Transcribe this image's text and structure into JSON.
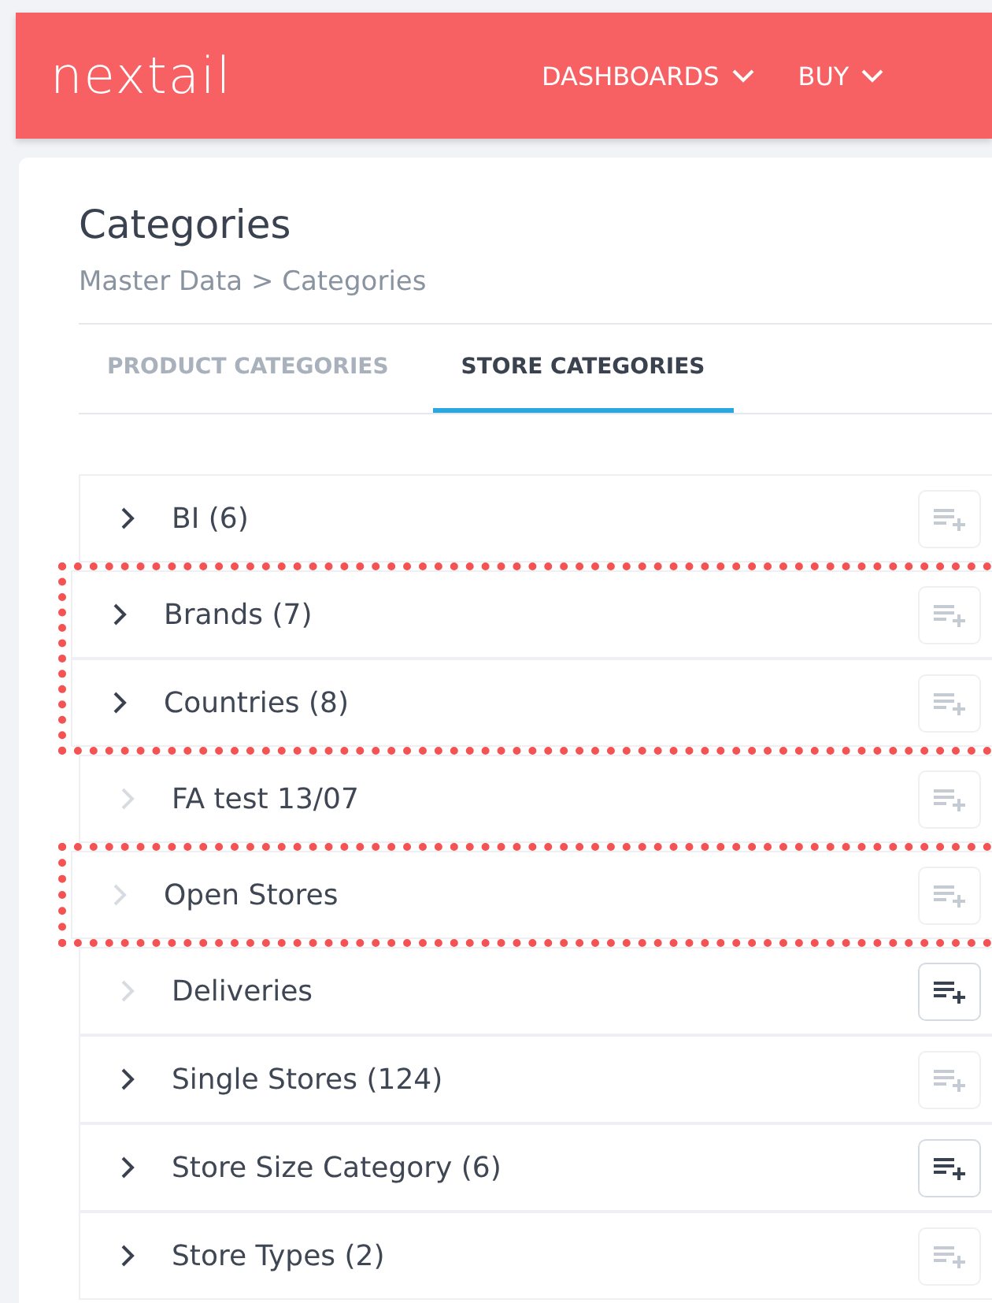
{
  "header": {
    "logo": "nextail",
    "nav": [
      {
        "label": "DASHBOARDS"
      },
      {
        "label": "BUY"
      }
    ]
  },
  "page": {
    "title": "Categories",
    "breadcrumb": "Master Data > Categories"
  },
  "tabs": [
    {
      "label": "PRODUCT CATEGORIES",
      "selected": false
    },
    {
      "label": "STORE CATEGORIES",
      "selected": true
    }
  ],
  "rows": [
    {
      "label": "BI (6)",
      "expandable": true,
      "add_enabled": false,
      "highlighted": false
    },
    {
      "label": "Brands (7)",
      "expandable": true,
      "add_enabled": false,
      "highlighted": true
    },
    {
      "label": "Countries (8)",
      "expandable": true,
      "add_enabled": false,
      "highlighted": true
    },
    {
      "label": "FA test 13/07",
      "expandable": false,
      "add_enabled": false,
      "highlighted": false
    },
    {
      "label": "Open Stores",
      "expandable": false,
      "add_enabled": false,
      "highlighted": true
    },
    {
      "label": "Deliveries",
      "expandable": false,
      "add_enabled": true,
      "highlighted": false
    },
    {
      "label": "Single Stores (124)",
      "expandable": true,
      "add_enabled": false,
      "highlighted": false
    },
    {
      "label": "Store Size Category (6)",
      "expandable": true,
      "add_enabled": true,
      "highlighted": false
    },
    {
      "label": "Store Types (2)",
      "expandable": true,
      "add_enabled": false,
      "highlighted": false
    }
  ]
}
